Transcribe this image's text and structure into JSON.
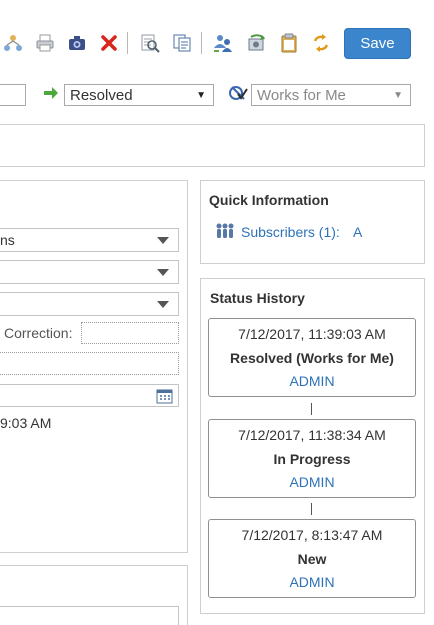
{
  "toolbar": {
    "icons": [
      {
        "name": "workflow-icon"
      },
      {
        "name": "print-icon"
      },
      {
        "name": "camera-icon"
      },
      {
        "name": "delete-icon"
      },
      {
        "name": "find-icon"
      },
      {
        "name": "copy-icon"
      },
      {
        "name": "users-icon"
      },
      {
        "name": "refresh-icon"
      },
      {
        "name": "clipboard-icon"
      },
      {
        "name": "swap-icon"
      }
    ],
    "save_label": "Save"
  },
  "status_row": {
    "status_value": "Resolved",
    "resolution_placeholder": "Works for Me"
  },
  "form": {
    "first_select_value": "ns",
    "correction_label": "Correction:",
    "time_text": "9:03 AM"
  },
  "quick_info": {
    "title": "Quick Information",
    "subscribers_label": "Subscribers (1):",
    "subscriber_name": "A"
  },
  "status_history": {
    "title": "Status History",
    "entries": [
      {
        "date": "7/12/2017, 11:39:03 AM",
        "status": "Resolved (Works for Me)",
        "user": "ADMIN"
      },
      {
        "date": "7/12/2017, 11:38:34 AM",
        "status": "In Progress",
        "user": "ADMIN"
      },
      {
        "date": "7/12/2017, 8:13:47 AM",
        "status": "New",
        "user": "ADMIN"
      }
    ]
  },
  "colors": {
    "accent": "#3a85cc",
    "link": "#2d72b8",
    "delete": "#d9261c"
  }
}
